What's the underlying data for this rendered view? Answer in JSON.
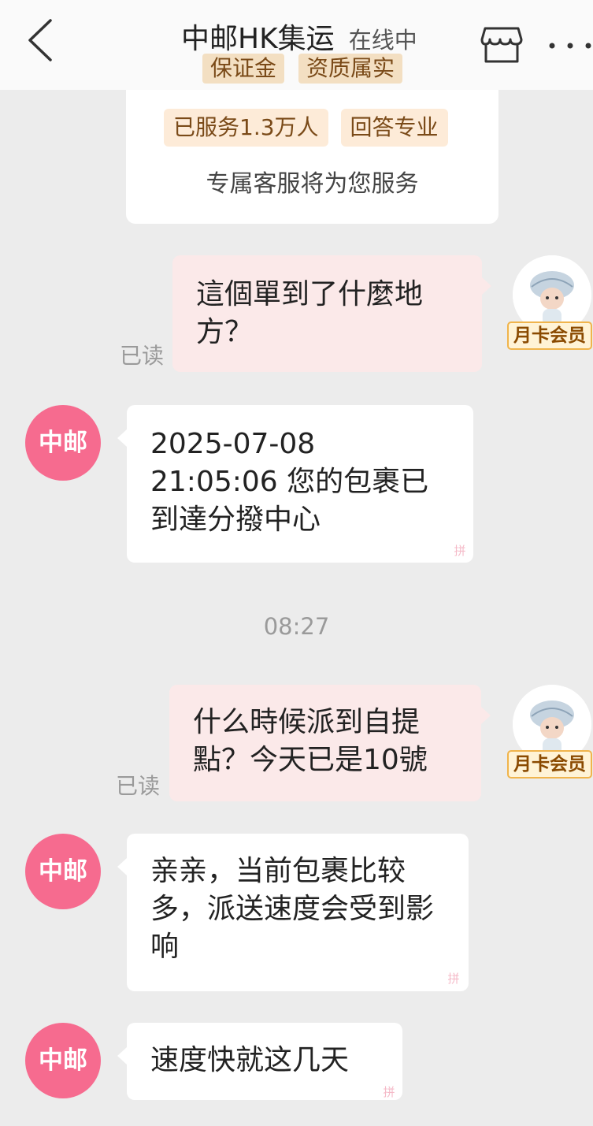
{
  "header": {
    "title": "中邮HK集运",
    "status": "在线中",
    "badges": [
      "保证金",
      "资质属实"
    ]
  },
  "info_card": {
    "tags": [
      "已服务1.3万人",
      "回答专业"
    ],
    "text": "专属客服将为您服务"
  },
  "shop": {
    "avatar_text": "中邮"
  },
  "user": {
    "member_badge": "月卡会员"
  },
  "messages": [
    {
      "side": "out",
      "text": "這個單到了什麼地方？",
      "read": "已读"
    },
    {
      "side": "in",
      "text": "2025-07-08 21:05:06 您的包裹已到達分撥中心"
    },
    {
      "side": "out",
      "text": "什么時候派到自提點？今天已是10號",
      "read": "已读"
    },
    {
      "side": "in",
      "text": "亲亲，当前包裹比较多，派送速度会受到影响"
    },
    {
      "side": "in",
      "text": "速度快就这几天"
    }
  ],
  "timestamp": "08:27",
  "colors": {
    "out_bubble": "#fbe9e9",
    "in_bubble": "#ffffff",
    "shop_avatar": "#f66b8f",
    "badge_bg": "#f3dfc2",
    "background": "#ececec"
  },
  "icons": [
    "back-arrow-icon",
    "shop-icon",
    "more-icon"
  ]
}
